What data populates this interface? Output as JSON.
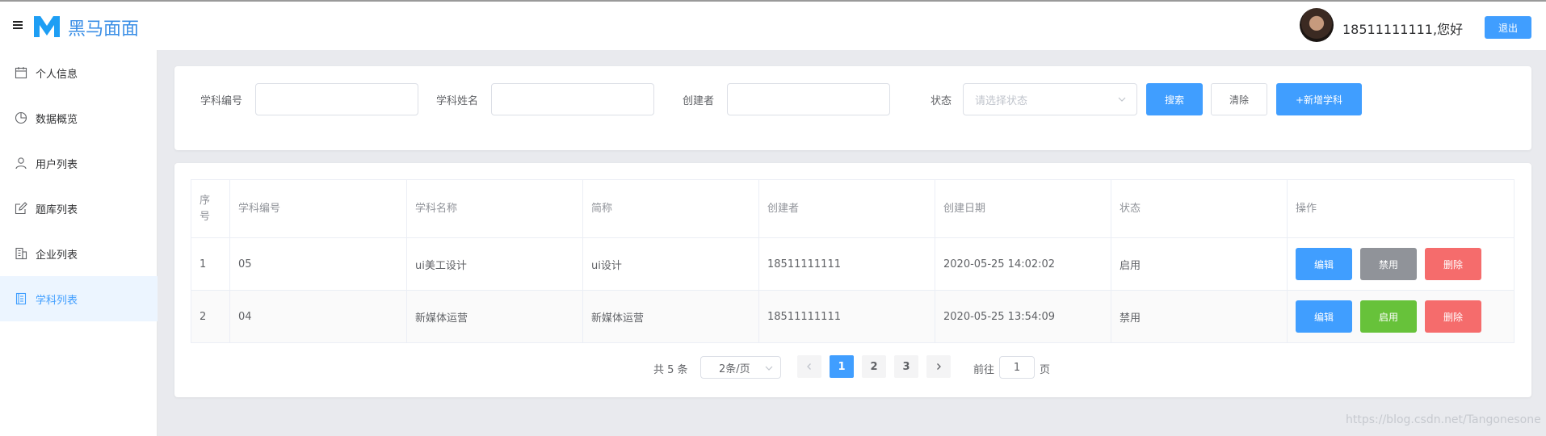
{
  "header": {
    "brand": "黑马面面",
    "greeting": "18511111111,您好",
    "logout_label": "退出"
  },
  "sidebar": {
    "items": [
      {
        "label": "个人信息",
        "icon": "calendar-icon"
      },
      {
        "label": "数据概览",
        "icon": "pie-chart-icon"
      },
      {
        "label": "用户列表",
        "icon": "user-icon"
      },
      {
        "label": "题库列表",
        "icon": "edit-icon"
      },
      {
        "label": "企业列表",
        "icon": "office-building-icon"
      },
      {
        "label": "学科列表",
        "icon": "notebook-icon",
        "active": true
      }
    ]
  },
  "search": {
    "subject_no_label": "学科编号",
    "subject_name_label": "学科姓名",
    "creator_label": "创建者",
    "status_label": "状态",
    "status_placeholder": "请选择状态",
    "search_label": "搜索",
    "clear_label": "清除",
    "add_label": "+新增学科"
  },
  "table": {
    "headers": [
      "序号",
      "学科编号",
      "学科名称",
      "简称",
      "创建者",
      "创建日期",
      "状态",
      "操作"
    ],
    "rows": [
      {
        "index": "1",
        "no": "05",
        "name": "ui美工设计",
        "short": "ui设计",
        "creator": "18511111111",
        "date": "2020-05-25 14:02:02",
        "status": "启用",
        "edit": "编辑",
        "toggle": "禁用",
        "delete": "删除"
      },
      {
        "index": "2",
        "no": "04",
        "name": "新媒体运营",
        "short": "新媒体运营",
        "creator": "18511111111",
        "date": "2020-05-25 13:54:09",
        "status": "禁用",
        "edit": "编辑",
        "toggle": "启用",
        "delete": "删除"
      }
    ]
  },
  "pagination": {
    "total": "共 5 条",
    "page_size": "2条/页",
    "pages": [
      "1",
      "2",
      "3"
    ],
    "current_page": "1",
    "goto_prefix": "前往",
    "goto_value": "1",
    "goto_suffix": "页"
  },
  "watermark": "https://blog.csdn.net/Tangonesone",
  "colors": {
    "primary": "#409eff",
    "success": "#67c23a",
    "danger": "#f56c6c",
    "info": "#909399"
  }
}
